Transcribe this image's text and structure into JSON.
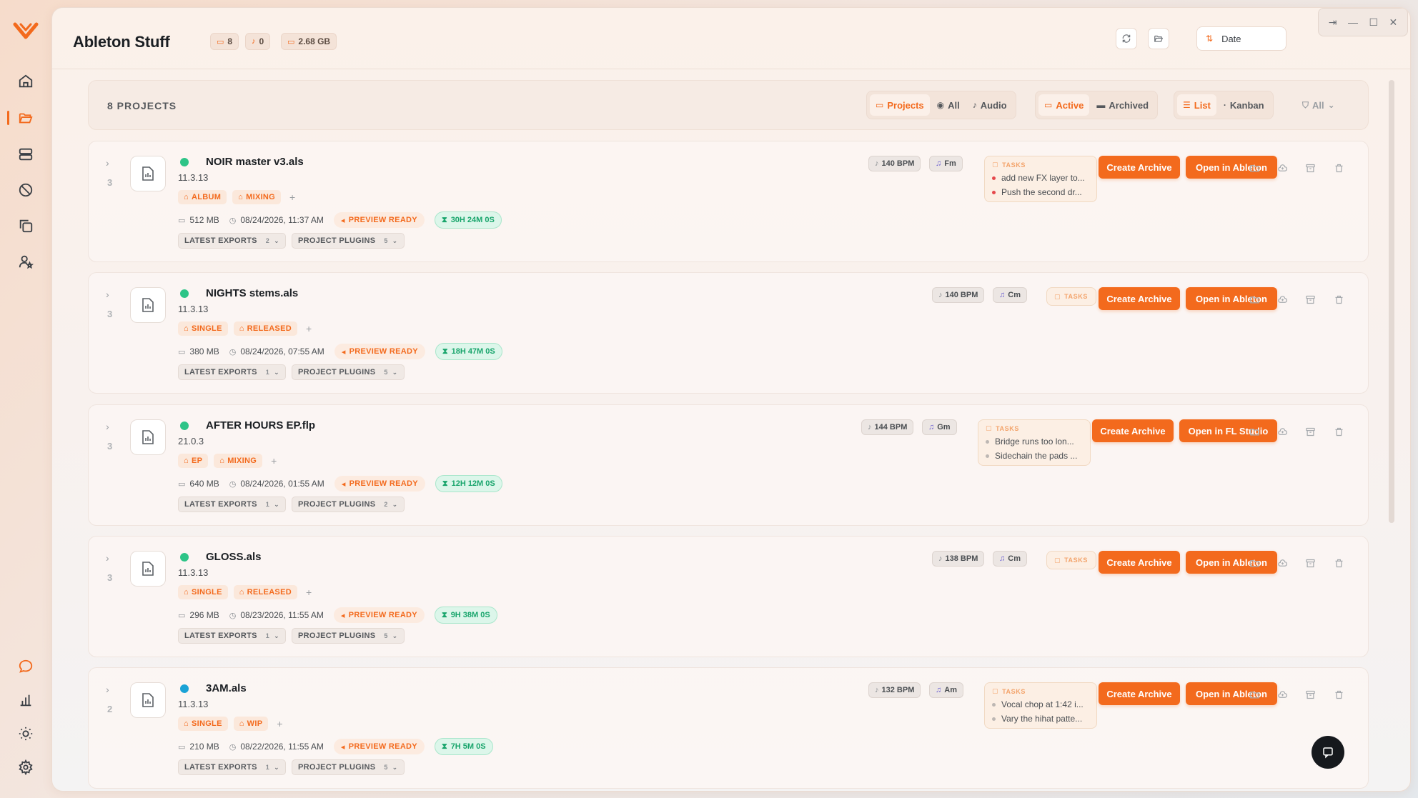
{
  "app": {
    "title": "Ableton Stuff"
  },
  "stats": {
    "folders": "8",
    "audio": "0",
    "size": "2.68 GB"
  },
  "sort": {
    "label": "Date"
  },
  "sidebar": {
    "items": [
      {
        "name": "home-icon"
      },
      {
        "name": "folder-open-icon"
      },
      {
        "name": "server-icon"
      },
      {
        "name": "ban-icon"
      },
      {
        "name": "copy-icon"
      },
      {
        "name": "user-star-icon"
      }
    ],
    "bottom": [
      {
        "name": "chat-bubble-icon"
      },
      {
        "name": "bar-chart-icon"
      },
      {
        "name": "sun-icon"
      },
      {
        "name": "settings-icon"
      }
    ]
  },
  "filterbar": {
    "count_label": "8 PROJECTS",
    "type_tabs": [
      "Projects",
      "All",
      "Audio"
    ],
    "state_tabs": [
      "Active",
      "Archived"
    ],
    "view_tabs": [
      "List",
      "Kanban"
    ],
    "filter_label": "All"
  },
  "projects": [
    {
      "name": "NOIR master v3.als",
      "version": "11.3.13",
      "count": "3",
      "status": "green",
      "tags": [
        "ALBUM",
        "MIXING"
      ],
      "size": "512 MB",
      "date": "08/24/2026, 11:37 AM",
      "preview": "PREVIEW READY",
      "duration": "30H 24M 0S",
      "exports_label": "LATEST EXPORTS",
      "exports_count": "2",
      "plugins_label": "PROJECT PLUGINS",
      "plugins_count": "5",
      "bpm": "140 BPM",
      "key": "Fm",
      "tasks_label": "TASKS",
      "tasks": [
        "add new FX layer to...",
        "Push the second dr..."
      ],
      "archive_label": "Create Archive",
      "open_label": "Open in Ableton"
    },
    {
      "name": "NIGHTS stems.als",
      "version": "11.3.13",
      "count": "3",
      "status": "green",
      "tags": [
        "SINGLE",
        "RELEASED"
      ],
      "size": "380 MB",
      "date": "08/24/2026, 07:55 AM",
      "preview": "PREVIEW READY",
      "duration": "18H 47M 0S",
      "exports_label": "LATEST EXPORTS",
      "exports_count": "1",
      "plugins_label": "PROJECT PLUGINS",
      "plugins_count": "5",
      "bpm": "140 BPM",
      "key": "Cm",
      "tasks_label": "TASKS",
      "tasks": [],
      "archive_label": "Create Archive",
      "open_label": "Open in Ableton"
    },
    {
      "name": "AFTER HOURS EP.flp",
      "version": "21.0.3",
      "count": "3",
      "status": "green",
      "tags": [
        "EP",
        "MIXING"
      ],
      "size": "640 MB",
      "date": "08/24/2026, 01:55 AM",
      "preview": "PREVIEW READY",
      "duration": "12H 12M 0S",
      "exports_label": "LATEST EXPORTS",
      "exports_count": "1",
      "plugins_label": "PROJECT PLUGINS",
      "plugins_count": "2",
      "bpm": "144 BPM",
      "key": "Gm",
      "tasks_label": "TASKS",
      "tasks": [
        "Bridge runs too lon...",
        "Sidechain the pads ..."
      ],
      "archive_label": "Create Archive",
      "open_label": "Open in FL Studio"
    },
    {
      "name": "GLOSS.als",
      "version": "11.3.13",
      "count": "3",
      "status": "green",
      "tags": [
        "SINGLE",
        "RELEASED"
      ],
      "size": "296 MB",
      "date": "08/23/2026, 11:55 AM",
      "preview": "PREVIEW READY",
      "duration": "9H 38M 0S",
      "exports_label": "LATEST EXPORTS",
      "exports_count": "1",
      "plugins_label": "PROJECT PLUGINS",
      "plugins_count": "5",
      "bpm": "138 BPM",
      "key": "Cm",
      "tasks_label": "TASKS",
      "tasks": [],
      "archive_label": "Create Archive",
      "open_label": "Open in Ableton"
    },
    {
      "name": "3AM.als",
      "version": "11.3.13",
      "count": "2",
      "status": "blue",
      "tags": [
        "SINGLE",
        "WIP"
      ],
      "size": "210 MB",
      "date": "08/22/2026, 11:55 AM",
      "preview": "PREVIEW READY",
      "duration": "7H 5M 0S",
      "exports_label": "LATEST EXPORTS",
      "exports_count": "1",
      "plugins_label": "PROJECT PLUGINS",
      "plugins_count": "5",
      "bpm": "132 BPM",
      "key": "Am",
      "tasks_label": "TASKS",
      "tasks": [
        "Vocal chop at 1:42 i...",
        "Vary the hihat patte..."
      ],
      "archive_label": "Create Archive",
      "open_label": "Open in Ableton"
    }
  ],
  "colors": {
    "accent": "#f36a1d",
    "success": "#19a56c",
    "active_dot": "#2dc487",
    "wip_dot": "#1aa3d6"
  }
}
